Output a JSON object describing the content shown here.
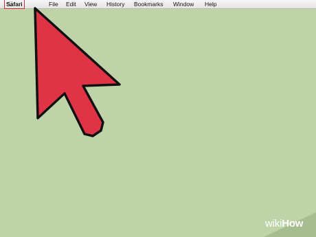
{
  "menubar": {
    "apple_icon": "apple-logo-icon",
    "items": [
      "Safari",
      "File",
      "Edit",
      "View",
      "History",
      "Bookmarks",
      "Window",
      "Help"
    ],
    "highlighted_item": "Safari"
  },
  "pointer": {
    "icon": "cursor-arrow-icon",
    "fill_color": "#e03446",
    "outline_color": "#111111"
  },
  "highlight_color": "#d8263a",
  "desktop": {
    "background_color": "#bed4a8"
  },
  "watermark": {
    "wiki": "wiki",
    "how": "How"
  }
}
